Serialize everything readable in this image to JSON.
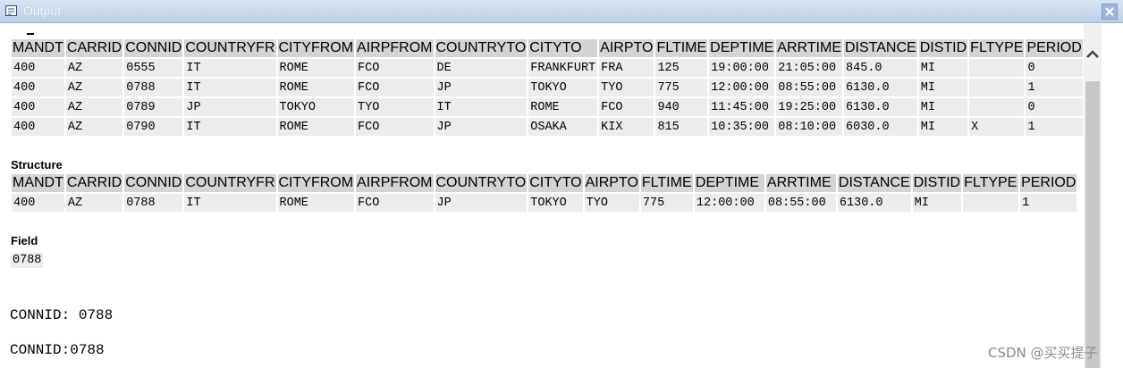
{
  "window": {
    "title": "Output",
    "icon": "output-window-icon"
  },
  "columns": [
    "MANDT",
    "CARRID",
    "CONNID",
    "COUNTRYFR",
    "CITYFROM",
    "AIRPFROM",
    "COUNTRYTO",
    "CITYTO",
    "AIRPTO",
    "FLTIME",
    "DEPTIME",
    "ARRTIME",
    "DISTANCE",
    "DISTID",
    "FLTYPE",
    "PERIOD"
  ],
  "table1": {
    "headers": [
      "MANDT",
      "CARRID",
      "CONNID",
      "COUNTRYFR",
      "CITYFROM",
      "AIRPFROM",
      "COUNTRYTO",
      "CITYTO",
      "AIRPTO",
      "FLTIME",
      "DEPTIME",
      "ARRTIME",
      "DISTANCE",
      "DISTID",
      "FLTYPE",
      "PERIOD"
    ],
    "rows": [
      [
        "400",
        "AZ",
        "0555",
        "IT",
        "ROME",
        "FCO",
        "DE",
        "FRANKFURT",
        "FRA",
        "125",
        "19:00:00",
        "21:05:00",
        "845.0",
        "MI",
        "",
        "0"
      ],
      [
        "400",
        "AZ",
        "0788",
        "IT",
        "ROME",
        "FCO",
        "JP",
        "TOKYO",
        "TYO",
        "775",
        "12:00:00",
        "08:55:00",
        "6130.0",
        "MI",
        "",
        "1"
      ],
      [
        "400",
        "AZ",
        "0789",
        "JP",
        "TOKYO",
        "TYO",
        "IT",
        "ROME",
        "FCO",
        "940",
        "11:45:00",
        "19:25:00",
        "6130.0",
        "MI",
        "",
        "0"
      ],
      [
        "400",
        "AZ",
        "0790",
        "IT",
        "ROME",
        "FCO",
        "JP",
        "OSAKA",
        "KIX",
        "815",
        "10:35:00",
        "08:10:00",
        "6030.0",
        "MI",
        "X",
        "1"
      ]
    ]
  },
  "structure": {
    "label": "Structure",
    "headers": [
      "MANDT",
      "CARRID",
      "CONNID",
      "COUNTRYFR",
      "CITYFROM",
      "AIRPFROM",
      "COUNTRYTO",
      "CITYTO",
      "AIRPTO",
      "FLTIME",
      "DEPTIME",
      "ARRTIME",
      "DISTANCE",
      "DISTID",
      "FLTYPE",
      "PERIOD"
    ],
    "row": [
      "400",
      "AZ",
      "0788",
      "IT",
      "ROME",
      "FCO",
      "JP",
      "TOKYO",
      "TYO",
      "775",
      "12:00:00",
      "08:55:00",
      "6130.0",
      "MI",
      "",
      "1"
    ]
  },
  "field": {
    "label": "Field",
    "value": "0788"
  },
  "lines": [
    "CONNID: 0788",
    "CONNID:0788"
  ],
  "watermark": "CSDN @买买提子"
}
